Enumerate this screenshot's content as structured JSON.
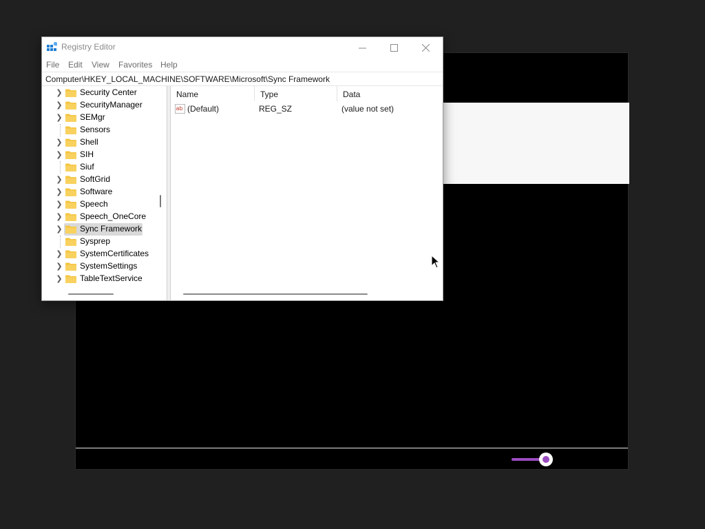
{
  "window": {
    "title": "Registry Editor",
    "controls": {
      "minimize": "minimize-icon",
      "maximize": "maximize-icon",
      "close": "close-icon"
    }
  },
  "menu": [
    "File",
    "Edit",
    "View",
    "Favorites",
    "Help"
  ],
  "address": "Computer\\HKEY_LOCAL_MACHINE\\SOFTWARE\\Microsoft\\Sync Framework",
  "tree": [
    {
      "label": "Security Center",
      "expandable": true
    },
    {
      "label": "SecurityManager",
      "expandable": true
    },
    {
      "label": "SEMgr",
      "expandable": true
    },
    {
      "label": "Sensors",
      "expandable": false
    },
    {
      "label": "Shell",
      "expandable": true
    },
    {
      "label": "SIH",
      "expandable": true
    },
    {
      "label": "Siuf",
      "expandable": false
    },
    {
      "label": "SoftGrid",
      "expandable": true
    },
    {
      "label": "Software",
      "expandable": true
    },
    {
      "label": "Speech",
      "expandable": true
    },
    {
      "label": "Speech_OneCore",
      "expandable": true
    },
    {
      "label": "Sync Framework",
      "expandable": true,
      "selected": true
    },
    {
      "label": "Sysprep",
      "expandable": false
    },
    {
      "label": "SystemCertificates",
      "expandable": true
    },
    {
      "label": "SystemSettings",
      "expandable": true
    },
    {
      "label": "TableTextService",
      "expandable": true
    }
  ],
  "columns": {
    "name": "Name",
    "type": "Type",
    "data": "Data"
  },
  "values": [
    {
      "name": "(Default)",
      "type": "REG_SZ",
      "data": "(value not set)"
    }
  ],
  "colors": {
    "accent": "#9b4cc0",
    "folder": "#f4c542",
    "selection": "#d9d9d9"
  }
}
